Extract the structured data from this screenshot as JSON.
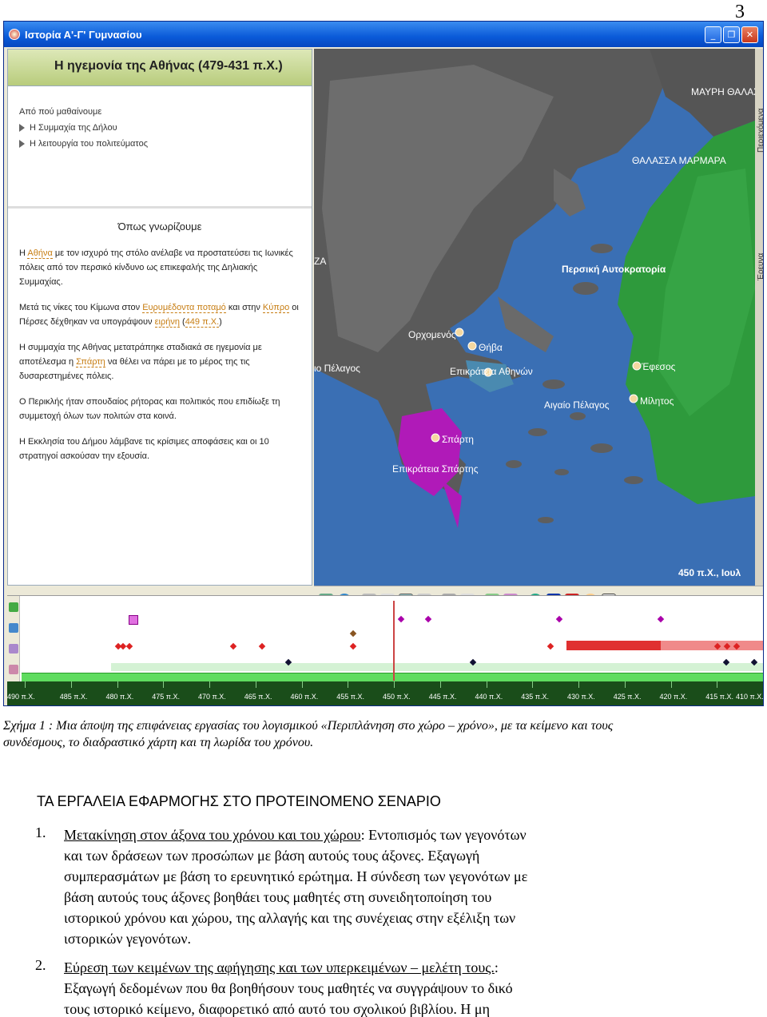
{
  "page_number": "3",
  "window": {
    "title": "Ιστορία Α'-Γ' Γυμνασίου",
    "buttons": [
      "_",
      "❐",
      "✕"
    ]
  },
  "left_panel": {
    "header": "Η ηγεμονία της Αθήνας (479-431 π.Χ.)",
    "learn_title": "Από πού μαθαίνουμε",
    "learn_items": [
      "Η Συμμαχία της Δήλου",
      "Η λειτουργία του πολιτεύματος"
    ],
    "know_title": "Όπως γνωρίζουμε",
    "p1": {
      "a": "Η ",
      "link": "Αθήνα",
      "b": " με τον ισχυρό της στόλο ανέλαβε να προστατεύσει τις Ιωνικές πόλεις από τον περσικό κίνδυνο ως επικεφαλής της Δηλιακής Συμμαχίας."
    },
    "p2": {
      "a": "Μετά τις νίκες του Κίμωνα στον ",
      "link1": "Ευρυμέδοντα ποταμό",
      "b": " και στην ",
      "link2": "Κύπρο",
      "c": " οι Πέρσες δέχθηκαν να υπογράψουν ",
      "link3": "ειρήνη",
      "d": " (",
      "link4": "449 π.Χ.",
      "e": ")"
    },
    "p3": {
      "a": "Η συμμαχία της Αθήνας μετατράπηκε σταδιακά σε ηγεμονία με αποτέλεσμα η ",
      "link": "Σπάρτη",
      "b": " να θέλει να πάρει με το μέρος της τις δυσαρεστημένες πόλεις."
    },
    "p4": "Ο Περικλής ήταν σπουδαίος ρήτορας και πολιτικός που επιδίωξε τη συμμετοχή όλων των πολιτών στα κοινά.",
    "p5": "Η Εκκλησία του Δήμου λάμβανε τις κρίσιμες αποφάσεις και οι 10 στρατηγοί ασκούσαν την εξουσία."
  },
  "map": {
    "labels": {
      "black_sea": "ΜΑΥΡΗ ΘΑΛΑΣΣΑ",
      "marmara": "ΘΑΛΑΣΣΑ ΜΑΡΜΑΡΑ",
      "persia": "Περσική Αυτοκρατορία",
      "orchomenos": "Ορχομενός",
      "thiva": "Θήβα",
      "athens_state": "Επικράτεια Αθηνών",
      "efesos": "Έφεσος",
      "militos": "Μίλητος",
      "aegean": "Αιγαίο Πέλαγος",
      "ionian": "ιο Πέλαγος",
      "sparti": "Σπάρτη",
      "sparta_state": "Επικράτεια Σπάρτης",
      "za": "ΖΑ",
      "date": "450 π.Χ., Ιουλ"
    },
    "side_tabs": [
      "Περιεχόμενα",
      "Έρευνα"
    ]
  },
  "timeline": {
    "ticks": [
      "490 π.Χ.",
      "485 π.Χ.",
      "480 π.Χ.",
      "475 π.Χ.",
      "470 π.Χ.",
      "465 π.Χ.",
      "460 π.Χ.",
      "455 π.Χ.",
      "450 π.Χ.",
      "445 π.Χ.",
      "440 π.Χ.",
      "435 π.Χ.",
      "430 π.Χ.",
      "425 π.Χ.",
      "420 π.Χ.",
      "415 π.Χ.",
      "410 π.Χ."
    ]
  },
  "caption": "Σχήμα 1 : Μια άποψη της επιφάνειας εργασίας του λογισμικού «Περιπλάνηση στο χώρο – χρόνο», με τα κείμενο και τους συνδέσμους, το διαδραστικό χάρτη και τη λωρίδα του χρόνου.",
  "heading": "ΤΑ ΕΡΓΑΛΕΙΑ ΕΦΑΡΜΟΓΗΣ ΣΤΟ ΠΡΟΤΕΙΝΟΜΕΝΟ ΣΕΝΑΡΙΟ",
  "item1": {
    "num": "1.",
    "underlined": "Μετακίνηση στον άξονα του χρόνου και του χώρου",
    "line1_rest": ": Εντοπισμός των γεγονότων",
    "line2": "και των δράσεων των προσώπων με βάση αυτούς τους άξονες. Εξαγωγή",
    "line3": "συμπερασμάτων με βάση το ερευνητικό ερώτημα. Η σύνδεση των γεγονότων με",
    "line4": "βάση αυτούς τους άξονες βοηθάει τους μαθητές στη συνειδητοποίηση του",
    "line5": "ιστορικού χρόνου και χώρου, της αλλαγής και της συνέχειας στην εξέλιξη των",
    "line6": "ιστορικών γεγονότων."
  },
  "item2": {
    "num": "2.",
    "underlined": "Εύρεση των κειμένων της αφήγησης και των υπερκειμένων – μελέτη τους.",
    "line1_rest": ":",
    "line2": "Εξαγωγή δεδομένων που θα βοηθήσουν τους μαθητές να συγγράψουν το δικό",
    "line3": "τους ιστορικό κείμενο, διαφορετικό από αυτό του σχολικού βιβλίου. Η μη"
  },
  "colors": {
    "sea": "#3a6fb4",
    "persia": "#2e9a3c",
    "sparta": "#b01ab8",
    "athens": "#4a8ab0",
    "titlebar": "#0a5ad8"
  }
}
